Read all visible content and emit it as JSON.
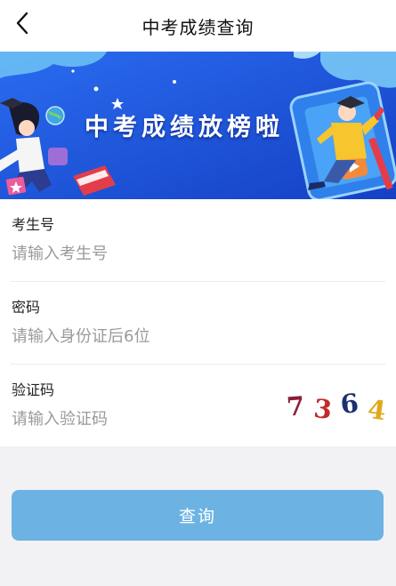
{
  "header": {
    "title": "中考成绩查询",
    "back_icon": "chevron-left-icon"
  },
  "banner": {
    "headline": "中考成绩放榜啦"
  },
  "form": {
    "exam_number": {
      "label": "考生号",
      "placeholder": "请输入考生号",
      "value": ""
    },
    "password": {
      "label": "密码",
      "placeholder": "请输入身份证后6位",
      "value": ""
    },
    "captcha": {
      "label": "验证码",
      "placeholder": "请输入验证码",
      "value": "",
      "image_chars": [
        "7",
        "3",
        "6",
        "4"
      ]
    }
  },
  "actions": {
    "query_label": "查询"
  },
  "colors": {
    "button": "#6cb3e3",
    "banner_blue": "#1e56d6",
    "background": "#f2f2f4"
  }
}
